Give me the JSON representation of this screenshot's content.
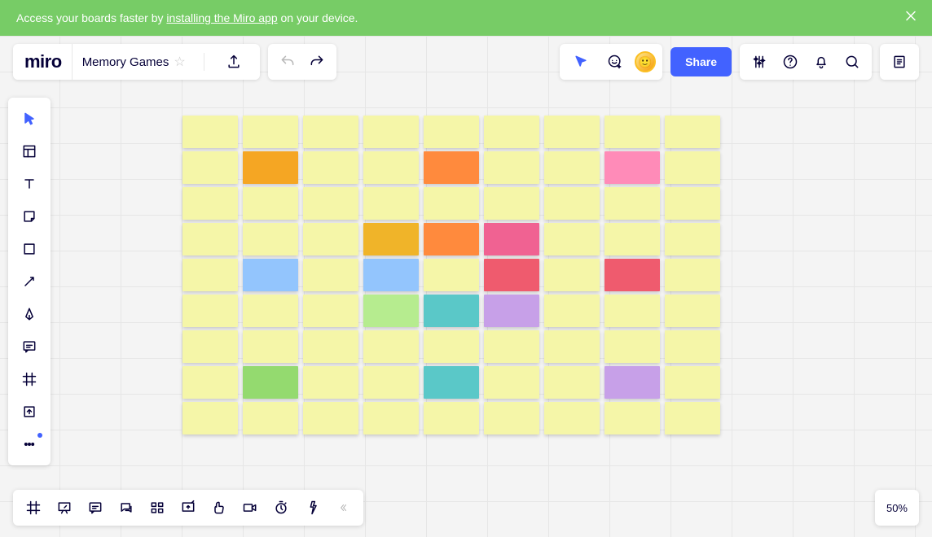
{
  "banner": {
    "prefix": "Access your boards faster by ",
    "link_text": "installing the Miro app",
    "suffix": " on your device."
  },
  "header": {
    "logo": "miro",
    "board_name": "Memory Games",
    "share_label": "Share"
  },
  "zoom_level": "50%",
  "grid": {
    "rows": 9,
    "cols": 9,
    "colored": [
      {
        "r": 1,
        "c": 1,
        "color": "orange"
      },
      {
        "r": 1,
        "c": 4,
        "color": "orange2"
      },
      {
        "r": 1,
        "c": 7,
        "color": "pink"
      },
      {
        "r": 3,
        "c": 3,
        "color": "gold"
      },
      {
        "r": 3,
        "c": 4,
        "color": "orange2"
      },
      {
        "r": 3,
        "c": 5,
        "color": "pink2"
      },
      {
        "r": 4,
        "c": 1,
        "color": "blue"
      },
      {
        "r": 4,
        "c": 3,
        "color": "blue"
      },
      {
        "r": 4,
        "c": 5,
        "color": "red"
      },
      {
        "r": 4,
        "c": 7,
        "color": "red"
      },
      {
        "r": 5,
        "c": 3,
        "color": "green"
      },
      {
        "r": 5,
        "c": 4,
        "color": "teal"
      },
      {
        "r": 5,
        "c": 5,
        "color": "purple"
      },
      {
        "r": 7,
        "c": 1,
        "color": "green2"
      },
      {
        "r": 7,
        "c": 4,
        "color": "teal"
      },
      {
        "r": 7,
        "c": 7,
        "color": "purple"
      }
    ]
  }
}
